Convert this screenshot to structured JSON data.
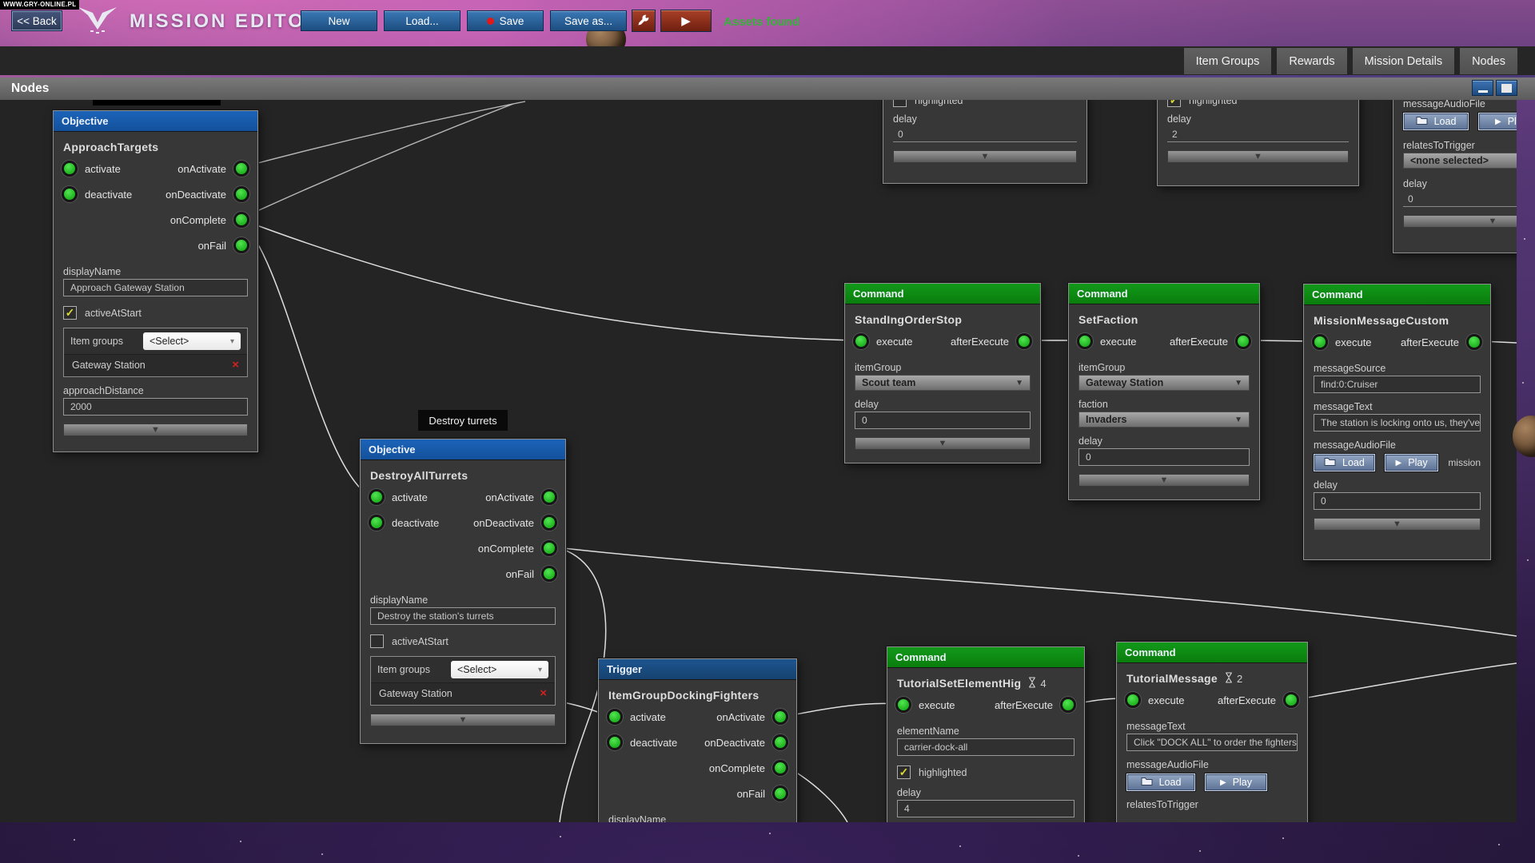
{
  "watermark": "WWW.GRY-ONLINE.PL",
  "toolbar": {
    "back": "<< Back",
    "title": "MISSION EDITOR",
    "new": "New",
    "load": "Load...",
    "save": "Save",
    "save_as": "Save as...",
    "status": "Assets found"
  },
  "tabs": [
    "Item Groups",
    "Rewards",
    "Mission Details",
    "Nodes"
  ],
  "panel": {
    "title": "Nodes"
  },
  "labels": {
    "display_name": "displayName",
    "active_at_start": "activeAtStart",
    "item_groups": "Item groups",
    "select": "<Select>",
    "item_group": "itemGroup",
    "faction": "faction",
    "delay": "delay",
    "message_source": "messageSource",
    "message_text": "messageText",
    "message_audio_file": "messageAudioFile",
    "relates_to_trigger": "relatesToTrigger",
    "element_name": "elementName",
    "highlighted": "highlighted",
    "approach_distance": "approachDistance",
    "load": "Load",
    "play": "Play",
    "none_selected": "<none selected>",
    "mission_note": "mission",
    "check": "✓"
  },
  "ports": {
    "activate": "activate",
    "deactivate": "deactivate",
    "on_activate": "onActivate",
    "on_deactivate": "onDeactivate",
    "on_complete": "onComplete",
    "on_fail": "onFail",
    "execute": "execute",
    "after_execute": "afterExecute"
  },
  "nodes": {
    "approach": {
      "type": "Objective",
      "name": "ApproachTargets",
      "display_name": "Approach Gateway Station",
      "item": "Gateway Station",
      "approach_distance": "2000"
    },
    "destroy": {
      "type": "Objective",
      "name": "DestroyAllTurrets",
      "tooltip": "Destroy turrets",
      "display_name": "Destroy the station's turrets",
      "item": "Gateway Station"
    },
    "docking": {
      "type": "Trigger",
      "name": "ItemGroupDockingFighters"
    },
    "standing": {
      "type": "Command",
      "name": "StandIngOrderStop",
      "item_group": "Scout team",
      "delay": "0"
    },
    "set_faction": {
      "type": "Command",
      "name": "SetFaction",
      "item_group": "Gateway Station",
      "faction": "Invaders",
      "delay": "0"
    },
    "mission_message": {
      "type": "Command",
      "name": "MissionMessageCustom",
      "message_source": "find:0:Cruiser",
      "message_text": "The station is locking onto us, they've g",
      "note": "mission",
      "delay": "0"
    },
    "tutorial_set": {
      "type": "Command",
      "name": "TutorialSetElementHig",
      "badge": "4",
      "element_name": "carrier-dock-all",
      "delay": "4"
    },
    "tutorial_message": {
      "type": "Command",
      "name": "TutorialMessage",
      "badge": "2",
      "message_text": "Click \"DOCK ALL\" to order the fighters t"
    },
    "partial_top_left": {
      "delay": "0"
    },
    "partial_top_mid": {
      "delay": "2"
    },
    "partial_top_right": {
      "relates_to": "<none selected>",
      "delay": "0"
    }
  },
  "connections": [
    "ApproachTargets.onComplete → DestroyAllTurrets.activate",
    "ApproachTargets.onComplete → StandIngOrderStop.execute",
    "StandIngOrderStop.afterExecute → SetFaction.execute",
    "SetFaction.afterExecute → MissionMessageCustom.execute",
    "ItemGroupDockingFighters.onActivate → TutorialSetElementHig.execute",
    "TutorialSetElementHig.afterExecute → TutorialMessage.execute"
  ],
  "colors": {
    "objective_header": "#14519c",
    "trigger_header": "#16426f",
    "command_header": "#0a7d0d",
    "port_green": "#2ec82e",
    "status_green": "#35b43a",
    "accent_blue": "#1d4e80",
    "danger_red": "#8a2a18"
  }
}
